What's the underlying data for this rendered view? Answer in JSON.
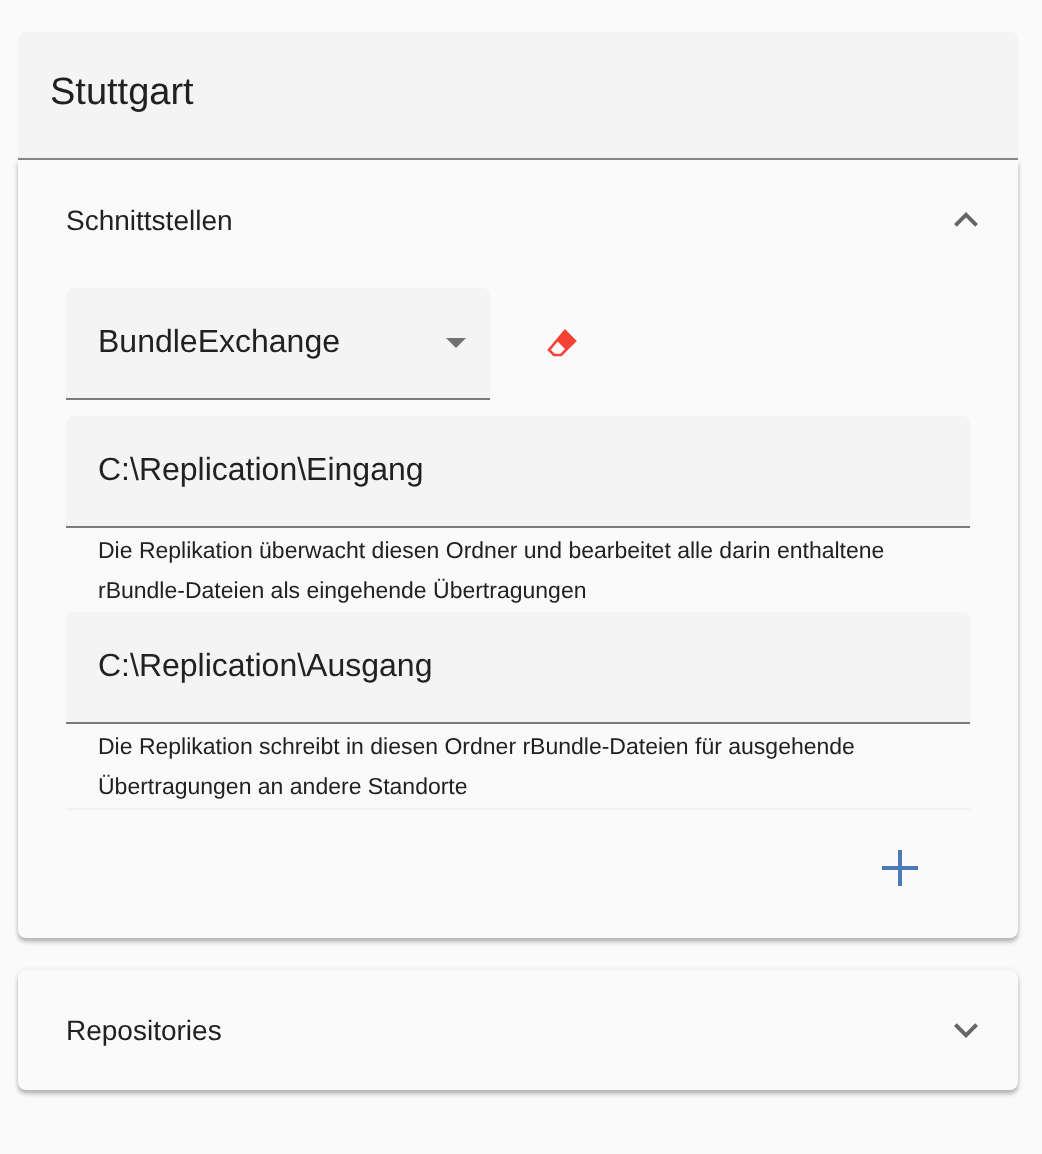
{
  "title": "Stuttgart",
  "panels": [
    {
      "title": "Schnittstellen",
      "expanded": true,
      "select": {
        "value": "BundleExchange"
      },
      "fields": [
        {
          "value": "C:\\Replication\\Eingang",
          "hint": "Die Replikation überwacht diesen Ordner und bearbeitet alle darin enthaltene rBundle-Dateien als eingehende Übertragungen"
        },
        {
          "value": "C:\\Replication\\Ausgang",
          "hint": "Die Replikation schreibt in diesen Ordner rBundle-Dateien für ausgehende Übertragungen an andere Standorte"
        }
      ]
    },
    {
      "title": "Repositories",
      "expanded": false
    }
  ]
}
